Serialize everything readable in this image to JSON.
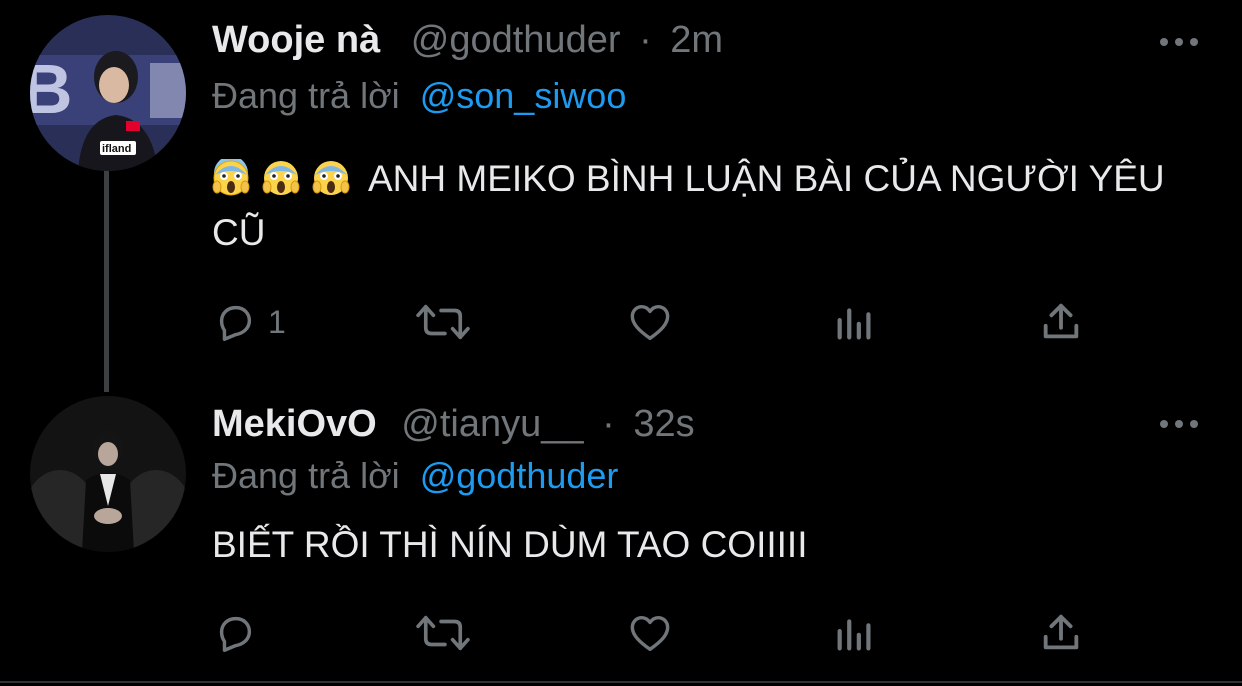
{
  "tweets": [
    {
      "display_name": "Wooje nà",
      "handle": "@godthuder",
      "separator": "·",
      "time": "2m",
      "replying_prefix": "Đang trả lời",
      "replying_to": "@son_siwoo",
      "emojis": [
        "face-screaming-in-fear",
        "face-screaming-in-fear",
        "face-screaming-in-fear"
      ],
      "text": "ANH MEIKO BÌNH LUẬN BÀI CỦA NGƯỜI YÊU CŨ",
      "reply_count": "1",
      "actions": [
        "reply-icon",
        "retweet-icon",
        "like-icon",
        "analytics-icon",
        "share-icon"
      ]
    },
    {
      "display_name": "MekiOvO",
      "handle": "@tianyu__",
      "separator": "·",
      "time": "32s",
      "replying_prefix": "Đang trả lời",
      "replying_to": "@godthuder",
      "text": "BIẾT RỒI THÌ NÍN DÙM TAO COIIIII",
      "reply_count": "",
      "actions": [
        "reply-icon",
        "retweet-icon",
        "like-icon",
        "analytics-icon",
        "share-icon"
      ]
    }
  ],
  "colors": {
    "background": "#000000",
    "text": "#e7e9ea",
    "muted": "#71767b",
    "link": "#1d9bf0",
    "thread_line": "#3d4043"
  }
}
